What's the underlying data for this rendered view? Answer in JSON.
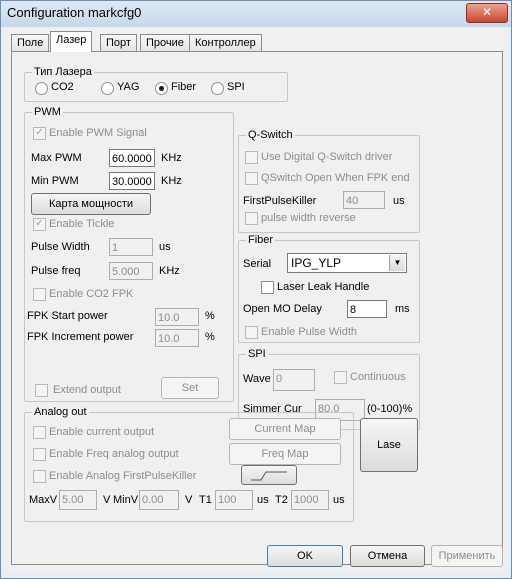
{
  "window": {
    "title": "Configuration markcfg0",
    "close_glyph": "✕"
  },
  "tabs": [
    "Поле",
    "Лазер",
    "Порт",
    "Прочие",
    "Контроллер"
  ],
  "laser_type": {
    "label": "Тип Лазера",
    "options": [
      "CO2",
      "YAG",
      "Fiber",
      "SPI"
    ],
    "selected": "Fiber"
  },
  "pwm": {
    "label": "PWM",
    "enable_pwm_signal": "Enable PWM Signal",
    "max_pwm_label": "Max PWM",
    "max_pwm_value": "60.0000",
    "max_pwm_unit": "KHz",
    "min_pwm_label": "Min PWM",
    "min_pwm_value": "30.0000",
    "min_pwm_unit": "KHz",
    "power_map_button": "Карта мощности",
    "enable_tickle": "Enable Tickle",
    "pulse_width_label": "Pulse Width",
    "pulse_width_value": "1",
    "pulse_width_unit": "us",
    "pulse_freq_label": "Pulse freq",
    "pulse_freq_value": "5.000",
    "pulse_freq_unit": "KHz",
    "enable_co2_fpk": "Enable CO2 FPK",
    "fpk_start_label": "FPK Start power",
    "fpk_start_value": "10.0",
    "fpk_start_unit": "%",
    "fpk_inc_label": "FPK Increment power",
    "fpk_inc_value": "10.0",
    "fpk_inc_unit": "%",
    "extend_output": "Extend output",
    "set_button": "Set"
  },
  "qswitch": {
    "label": "Q-Switch",
    "use_digital": "Use Digital Q-Switch driver",
    "open_when_fpk": "QSwitch Open When FPK end",
    "first_pulse_label": "FirstPulseKiller",
    "first_pulse_value": "40",
    "first_pulse_unit": "us",
    "pulse_width_reverse": "pulse width reverse"
  },
  "fiber": {
    "label": "Fiber",
    "serial_label": "Serial",
    "serial_value": "IPG_YLP",
    "laser_leak_handle": "Laser Leak Handle",
    "open_mo_label": "Open MO Delay",
    "open_mo_value": "8",
    "open_mo_unit": "ms",
    "enable_pulse_width": "Enable Pulse Width"
  },
  "spi": {
    "label": "SPI",
    "wave_label": "Wave",
    "wave_value": "0",
    "continuous": "Continuous",
    "simmer_label": "Simmer Cur",
    "simmer_value": "80.0",
    "simmer_unit": "(0-100)%"
  },
  "analog": {
    "label": "Analog out",
    "enable_current_output": "Enable current output",
    "enable_freq_analog_output": "Enable Freq analog output",
    "enable_analog_fpk": "Enable Analog FirstPulseKiller",
    "current_map_button": "Current Map",
    "freq_map_button": "Freq Map",
    "maxv_label": "MaxV",
    "maxv_value": "5.00",
    "v_unit1": "V",
    "minv_label": "MinV",
    "minv_value": "0.00",
    "v_unit2": "V",
    "t1_label": "T1",
    "t1_value": "100",
    "t1_unit": "us",
    "t2_label": "T2",
    "t2_value": "1000",
    "t2_unit": "us"
  },
  "lase_button": "Lase",
  "footer": {
    "ok": "OK",
    "cancel": "Отмена",
    "apply": "Применить"
  }
}
